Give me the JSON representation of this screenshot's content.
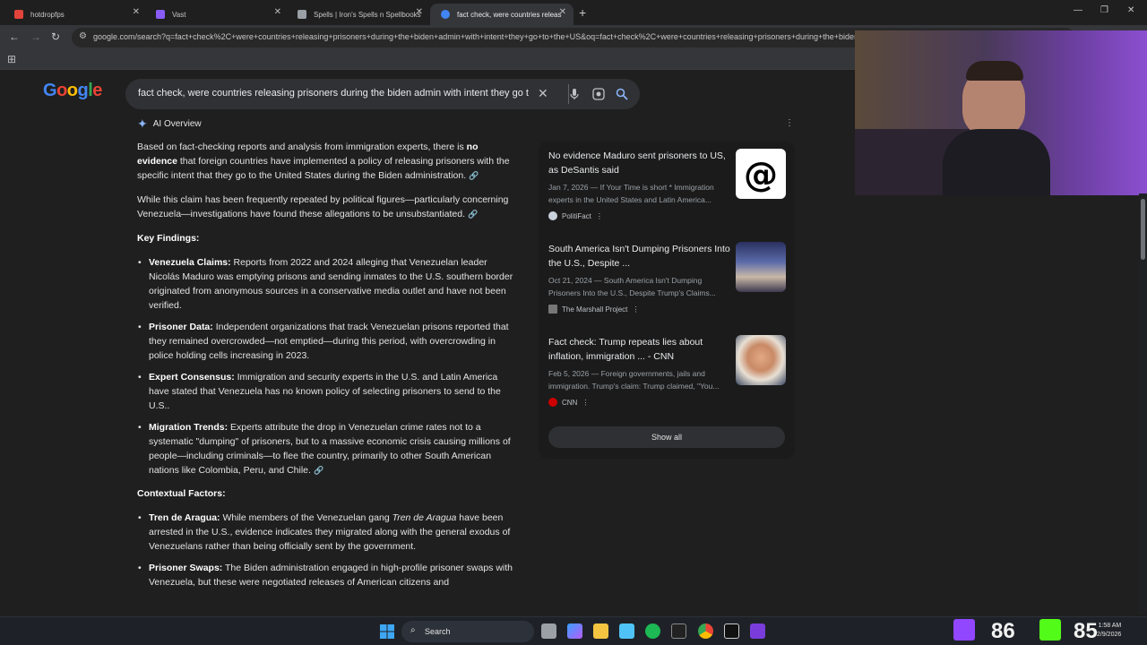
{
  "browser": {
    "tabs": [
      {
        "title": "hotdropfps",
        "color": "#e2433a"
      },
      {
        "title": "Vast",
        "color": "#8a5cf6"
      },
      {
        "title": "Spells | Iron's Spells n Spellbooks",
        "color": "#9aa0a6"
      },
      {
        "title": "fact check, were countries releas",
        "color": "#4285f4",
        "active": true
      }
    ],
    "url": "google.com/search?q=fact+check%2C+were+countries+releasing+prisoners+during+the+biden+admin+with+intent+they+go+to+the+US&oq=fact+check%2C+were+countries+releasing+prisoners+during+the+biden+admin+with+intent+they+go+to+the+US"
  },
  "google": {
    "logo": "Google",
    "query": "fact check, were countries releasing prisoners during the biden admin with intent they go t"
  },
  "ai_overview": {
    "label": "AI Overview",
    "p1_pre": "Based on fact-checking reports and analysis from immigration experts, there is ",
    "p1_bold1": "no",
    "p1_bold2": "evidence",
    "p1_post": " that foreign countries have implemented a policy of releasing prisoners with the specific intent that they go to the United States during the Biden administration.",
    "p2": "While this claim has been frequently repeated by political figures—particularly concerning Venezuela—investigations have found these allegations to be unsubstantiated.",
    "key_findings_heading": "Key Findings:",
    "key_findings": [
      {
        "label": "Venezuela Claims:",
        "text": " Reports from 2022 and 2024 alleging that Venezuelan leader Nicolás Maduro was emptying prisons and sending inmates to the U.S. southern border originated from anonymous sources in a conservative media outlet and have not been verified."
      },
      {
        "label": "Prisoner Data:",
        "text": " Independent organizations that track Venezuelan prisons reported that they remained overcrowded—not emptied—during this period, with overcrowding in police holding cells increasing in 2023."
      },
      {
        "label": "Expert Consensus:",
        "text": " Immigration and security experts in the U.S. and Latin America have stated that Venezuela has no known policy of selecting prisoners to send to the U.S.."
      },
      {
        "label": "Migration Trends:",
        "text": " Experts attribute the drop in Venezuelan crime rates not to a systematic \"dumping\" of prisoners, but to a massive economic crisis causing millions of people—including criminals—to flee the country, primarily to other South American nations like Colombia, Peru, and Chile."
      }
    ],
    "contextual_heading": "Contextual Factors:",
    "tren_label": "Tren de Aragua:",
    "tren_pre": " While members of the Venezuelan gang ",
    "tren_italic": "Tren de Aragua",
    "tren_post": " have been arrested in the U.S., evidence indicates they migrated along with the general exodus of Venezuelans rather than being officially sent by the government.",
    "swap_label": "Prisoner Swaps:",
    "swap_text": " The Biden administration engaged in high-profile prisoner swaps with Venezuela, but these were negotiated releases of American citizens and"
  },
  "sources": [
    {
      "title": "No evidence Maduro sent prisoners to US, as DeSantis said",
      "snippet": "Jan 7, 2026 — If Your Time is short * Immigration experts in the United States and Latin America...",
      "site": "PolitiFact",
      "site_color": "#c9d2dc",
      "thumb": "threads"
    },
    {
      "title": "South America Isn't Dumping Prisoners Into the U.S., Despite ...",
      "snippet": "Oct 21, 2024 — South America Isn't Dumping Prisoners Into the U.S., Despite Trump's Claims...",
      "site": "The Marshall Project",
      "site_color": "#777777",
      "thumb": "photo-group"
    },
    {
      "title": "Fact check: Trump repeats lies about inflation, immigration ... - CNN",
      "snippet": "Feb 5, 2026 — Foreign governments, jails and immigration. Trump's claim: Trump claimed, \"You...",
      "site": "CNN",
      "site_color": "#cc0000",
      "thumb": "photo-portrait"
    }
  ],
  "show_all": "Show all",
  "taskbar": {
    "search": "Search",
    "stat1": "86",
    "stat2": "85",
    "time": "1:58 AM",
    "date": "2/9/2026"
  }
}
